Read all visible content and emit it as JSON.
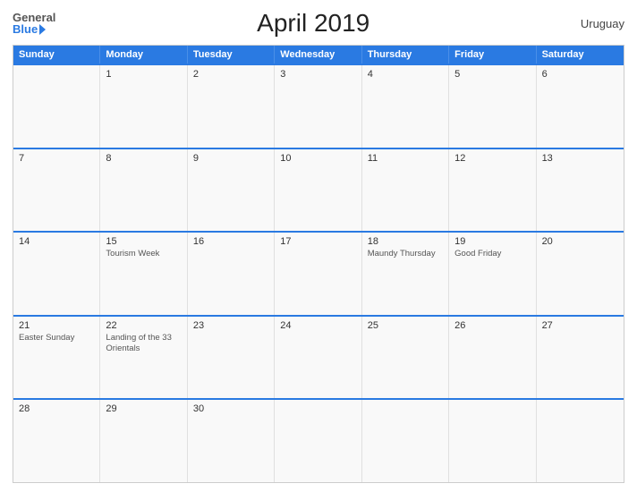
{
  "header": {
    "logo_general": "General",
    "logo_blue": "Blue",
    "title": "April 2019",
    "country": "Uruguay"
  },
  "days_of_week": [
    "Sunday",
    "Monday",
    "Tuesday",
    "Wednesday",
    "Thursday",
    "Friday",
    "Saturday"
  ],
  "weeks": [
    [
      {
        "day": "",
        "holiday": ""
      },
      {
        "day": "1",
        "holiday": ""
      },
      {
        "day": "2",
        "holiday": ""
      },
      {
        "day": "3",
        "holiday": ""
      },
      {
        "day": "4",
        "holiday": ""
      },
      {
        "day": "5",
        "holiday": ""
      },
      {
        "day": "6",
        "holiday": ""
      }
    ],
    [
      {
        "day": "7",
        "holiday": ""
      },
      {
        "day": "8",
        "holiday": ""
      },
      {
        "day": "9",
        "holiday": ""
      },
      {
        "day": "10",
        "holiday": ""
      },
      {
        "day": "11",
        "holiday": ""
      },
      {
        "day": "12",
        "holiday": ""
      },
      {
        "day": "13",
        "holiday": ""
      }
    ],
    [
      {
        "day": "14",
        "holiday": ""
      },
      {
        "day": "15",
        "holiday": "Tourism Week"
      },
      {
        "day": "16",
        "holiday": ""
      },
      {
        "day": "17",
        "holiday": ""
      },
      {
        "day": "18",
        "holiday": "Maundy Thursday"
      },
      {
        "day": "19",
        "holiday": "Good Friday"
      },
      {
        "day": "20",
        "holiday": ""
      }
    ],
    [
      {
        "day": "21",
        "holiday": "Easter Sunday"
      },
      {
        "day": "22",
        "holiday": "Landing of the 33 Orientals"
      },
      {
        "day": "23",
        "holiday": ""
      },
      {
        "day": "24",
        "holiday": ""
      },
      {
        "day": "25",
        "holiday": ""
      },
      {
        "day": "26",
        "holiday": ""
      },
      {
        "day": "27",
        "holiday": ""
      }
    ],
    [
      {
        "day": "28",
        "holiday": ""
      },
      {
        "day": "29",
        "holiday": ""
      },
      {
        "day": "30",
        "holiday": ""
      },
      {
        "day": "",
        "holiday": ""
      },
      {
        "day": "",
        "holiday": ""
      },
      {
        "day": "",
        "holiday": ""
      },
      {
        "day": "",
        "holiday": ""
      }
    ]
  ]
}
